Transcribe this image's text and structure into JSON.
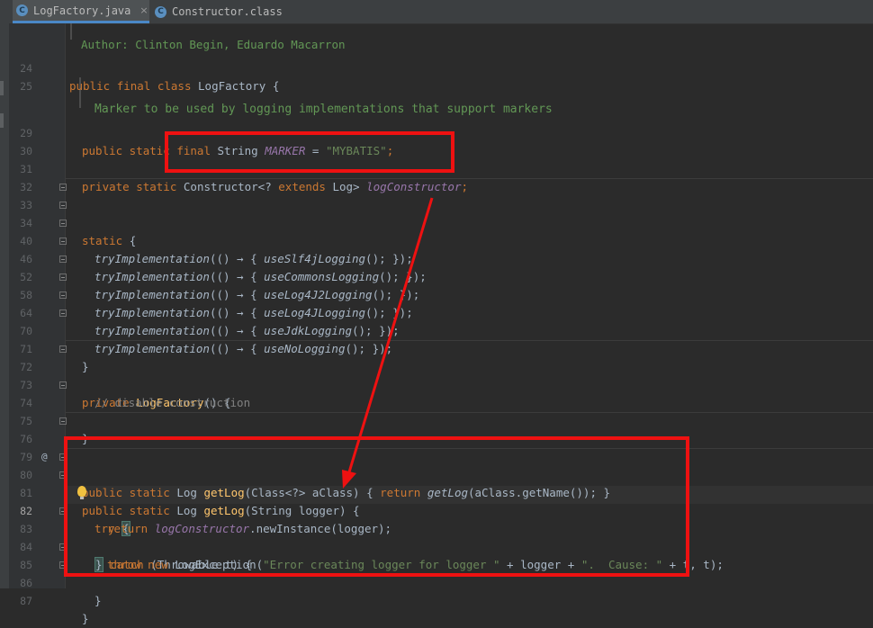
{
  "tabs": [
    {
      "label": "LogFactory.java",
      "icon": "class-icon",
      "active": true,
      "close": "×"
    },
    {
      "label": "Constructor.class",
      "icon": "class-icon",
      "active": false
    }
  ],
  "gutter": {
    "line_numbers": [
      "24",
      "25",
      "29",
      "30",
      "31",
      "32",
      "33",
      "34",
      "40",
      "46",
      "52",
      "58",
      "64",
      "70",
      "71",
      "72",
      "73",
      "74",
      "75",
      "76",
      "79",
      "80",
      "81",
      "82",
      "83",
      "84",
      "85",
      "86",
      "87"
    ],
    "current_line": "82",
    "override_marker": "@"
  },
  "code": {
    "author_line": "Author: Clinton Begin, Eduardo Macarron",
    "class_decl": [
      "public",
      "final",
      "class",
      "LogFactory",
      "{"
    ],
    "doc_comment": "Marker to be used by logging implementations that support markers",
    "marker": {
      "mods": "public static final",
      "type": "String",
      "name": "MARKER",
      "eq": " = ",
      "value": "\"MYBATIS\"",
      "end": ";"
    },
    "ctor_field": {
      "mods": "private static",
      "type": "Constructor<?",
      "ext": "extends",
      "logtype": "Log>",
      "name": "logConstructor",
      "end": ";"
    },
    "static_kw": "static",
    "static_open": "{",
    "try_impls": [
      {
        "fn": "tryImplementation",
        "call": "useSlf4jLogging"
      },
      {
        "fn": "tryImplementation",
        "call": "useCommonsLogging"
      },
      {
        "fn": "tryImplementation",
        "call": "useLog4J2Logging"
      },
      {
        "fn": "tryImplementation",
        "call": "useLog4JLogging"
      },
      {
        "fn": "tryImplementation",
        "call": "useJdkLogging"
      },
      {
        "fn": "tryImplementation",
        "call": "useNoLogging"
      }
    ],
    "lambda_open": "(() → { ",
    "lambda_close": "(); });",
    "close_brace": "}",
    "private_ctor": {
      "kw": "private",
      "name": "LogFactory",
      "rest": "() {"
    },
    "disable_comment": "// disable construction",
    "getlog_class": {
      "mods": "public static",
      "type": "Log",
      "name": "getLog",
      "params": "(Class<?> aClass)",
      "body_open": " { ",
      "ret": "return",
      "call": "getLog",
      "args": "(aClass.getName()); }"
    },
    "getlog_string": {
      "mods": "public static",
      "type": "Log",
      "name": "getLog",
      "params": "(String logger) {"
    },
    "try_kw": "try",
    "try_brace": "{",
    "return_kw": "return",
    "return_field": "logConstructor",
    "return_call": ".newInstance(logger);",
    "catch_close": "}",
    "catch_kw": "catch",
    "catch_params": " (Throwable t) {",
    "throw_kw": "throw",
    "new_kw": "new",
    "exc_type": "LogException(",
    "msg1": "\"Error creating logger for logger \"",
    "concat1": " + logger + ",
    "msg2": "\".  Cause: \"",
    "concat2": " + t, t);"
  }
}
